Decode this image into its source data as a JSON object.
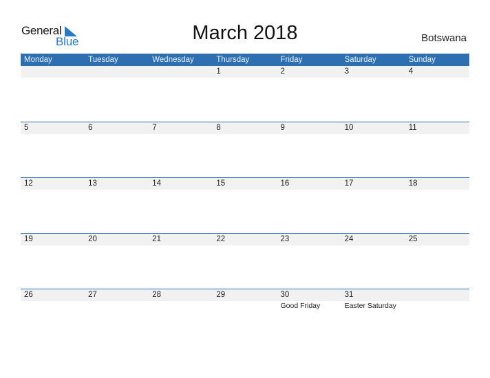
{
  "logo": {
    "general": "General",
    "blue": "Blue"
  },
  "title": "March 2018",
  "country": "Botswana",
  "accent_color": "#2e6fb1",
  "weekdays": [
    "Monday",
    "Tuesday",
    "Wednesday",
    "Thursday",
    "Friday",
    "Saturday",
    "Sunday"
  ],
  "weeks": [
    {
      "days": [
        "",
        "",
        "",
        "1",
        "2",
        "3",
        "4"
      ],
      "events": [
        "",
        "",
        "",
        "",
        "",
        "",
        ""
      ]
    },
    {
      "days": [
        "5",
        "6",
        "7",
        "8",
        "9",
        "10",
        "11"
      ],
      "events": [
        "",
        "",
        "",
        "",
        "",
        "",
        ""
      ]
    },
    {
      "days": [
        "12",
        "13",
        "14",
        "15",
        "16",
        "17",
        "18"
      ],
      "events": [
        "",
        "",
        "",
        "",
        "",
        "",
        ""
      ]
    },
    {
      "days": [
        "19",
        "20",
        "21",
        "22",
        "23",
        "24",
        "25"
      ],
      "events": [
        "",
        "",
        "",
        "",
        "",
        "",
        ""
      ]
    },
    {
      "days": [
        "26",
        "27",
        "28",
        "29",
        "30",
        "31",
        ""
      ],
      "events": [
        "",
        "",
        "",
        "",
        "Good Friday",
        "Easter Saturday",
        ""
      ]
    }
  ]
}
